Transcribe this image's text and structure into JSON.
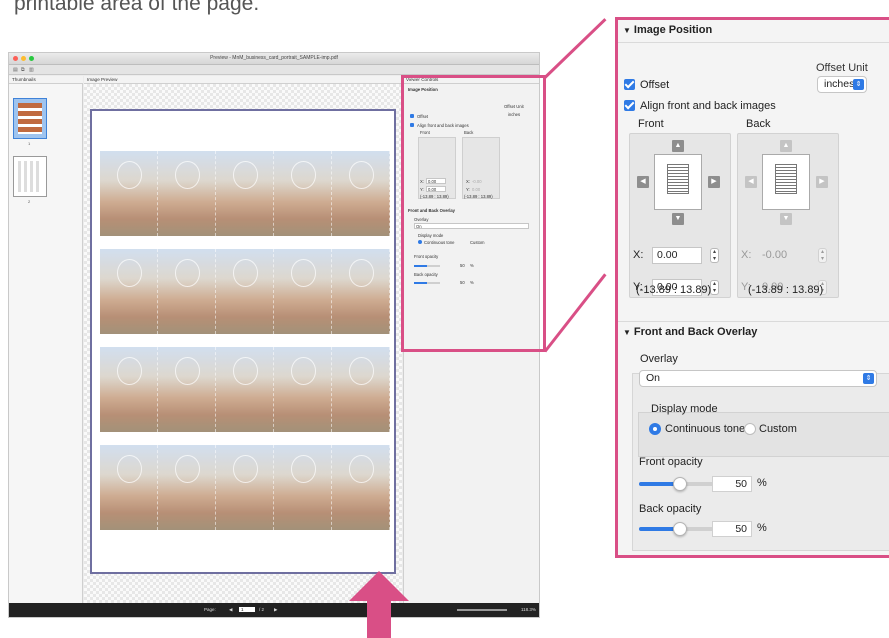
{
  "caption": "printable area of the page.",
  "window": {
    "title": "Preview - MnM_business_card_portrait_SAMPLE-imp.pdf",
    "thumbnails_label": "Thumbnails",
    "preview_label": "Image Preview",
    "thumb_numbers": [
      "1",
      "2"
    ],
    "status": {
      "page_label": "Page:",
      "page_value": "1",
      "page_total": "/ 2",
      "zoom": "118.3%"
    }
  },
  "mini_panel": {
    "viewer_controls": "Viewer Controls",
    "image_position": "Image Position",
    "offset_unit": "Offset Unit",
    "offset": "Offset",
    "unit": "inches",
    "align": "Align front and back images",
    "front": "Front",
    "back": "Back",
    "x_label": "X:",
    "y_label": "Y:",
    "x_val": "0.00",
    "y_val": "0.00",
    "x_back": "-0.00",
    "y_back": "0.00",
    "range": "(-13.89 : 13.89)",
    "overlay_head": "Front and Back Overlay",
    "overlay": "Overlay",
    "overlay_val": "On",
    "display_mode": "Display mode",
    "continuous": "Continuous tone",
    "custom": "Custom",
    "front_opacity": "Front opacity",
    "back_opacity": "Back opacity",
    "front_pct": "50",
    "back_pct": "50",
    "pct": "%"
  },
  "panel": {
    "image_position": "Image Position",
    "offset_unit_label": "Offset Unit",
    "offset_label": "Offset",
    "offset_unit_value": "inches",
    "align_label": "Align front and back images",
    "front_label": "Front",
    "back_label": "Back",
    "front_x_label": "X:",
    "front_x_value": "0.00",
    "front_y_label": "Y:",
    "front_y_value": "0.00",
    "back_x_label": "X:",
    "back_x_value": "-0.00",
    "back_y_label": "Y:",
    "back_y_value": "0.00",
    "front_range": "(-13.89 : 13.89)",
    "back_range": "(-13.89 : 13.89)",
    "overlay_section": "Front and Back Overlay",
    "overlay_label": "Overlay",
    "overlay_value": "On",
    "display_mode_label": "Display mode",
    "mode_continuous": "Continuous tone",
    "mode_custom": "Custom",
    "front_opacity_label": "Front opacity",
    "front_opacity_value": "50",
    "back_opacity_label": "Back opacity",
    "back_opacity_value": "50",
    "percent": "%"
  },
  "opacity_levels": {
    "front": 0.5,
    "back": 0.5
  },
  "colors": {
    "highlight": "#d94f86",
    "accent": "#2f7ae5"
  }
}
